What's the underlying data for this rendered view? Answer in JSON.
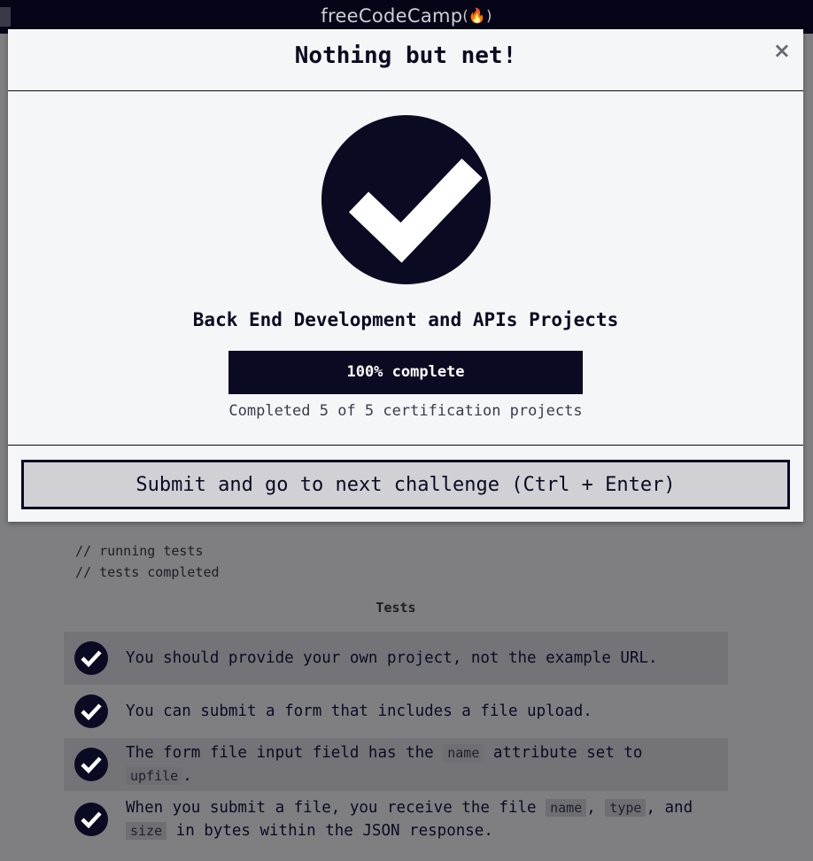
{
  "navbar": {
    "brand": "freeCodeCamp",
    "brand_flame": "(🔥)"
  },
  "console": {
    "lines": [
      "// running tests",
      "// tests completed"
    ]
  },
  "tests": {
    "heading": "Tests",
    "items": [
      {
        "text": "You should provide your own project, not the example URL.",
        "passed": true
      },
      {
        "text": "You can submit a form that includes a file upload.",
        "passed": true
      },
      {
        "text_parts": [
          "The form file input field has the ",
          "name",
          " attribute set to ",
          "upfile",
          "."
        ],
        "passed": true
      },
      {
        "text_parts": [
          "When you submit a file, you receive the file ",
          "name",
          ", ",
          "type",
          ", and ",
          "size",
          " in bytes within the JSON response."
        ],
        "passed": true
      }
    ]
  },
  "modal": {
    "title": "Nothing but net!",
    "close_label": "×",
    "check_icon": "checkmark-icon",
    "cert_title": "Back End Development and APIs Projects",
    "progress": {
      "percent": 100,
      "label": "100% complete"
    },
    "completed_text": "Completed 5 of 5 certification projects",
    "submit_label": "Submit and go to next challenge (Ctrl + Enter)"
  },
  "colors": {
    "navy": "#0a0a23",
    "overlay": "#7f7f82",
    "modal_bg": "#f5f6f7",
    "button_bg": "#d0d0d5"
  }
}
